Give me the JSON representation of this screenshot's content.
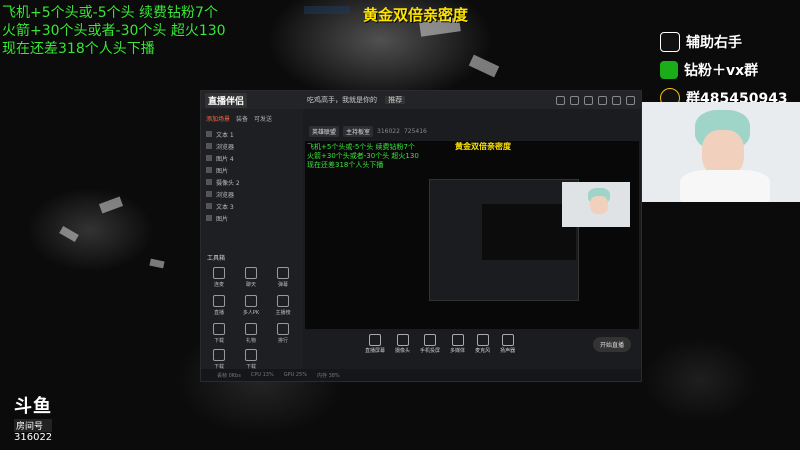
{
  "overlay": {
    "lines": [
      "飞机+5个头或-5个头 续费钻粉7个",
      "火箭+30个头或者-30个头 超火130",
      "现在还差318个人头下播"
    ]
  },
  "banner": "黄金双倍亲密度",
  "social": {
    "douyin": "辅助右手",
    "wechat": "钻粉＋vx群",
    "qq": "群485450943"
  },
  "douyu": {
    "logo": "斗鱼",
    "label": "房间号",
    "room": "316022"
  },
  "app": {
    "title": "直播伴侣",
    "version_badge": "",
    "left_tabs": [
      "添加场景",
      "装备",
      "可发送"
    ],
    "scenes": [
      "文本 1",
      "浏览器",
      "图片 4",
      "图片",
      "摄像头 2",
      "浏览器",
      "文本 3",
      "图片"
    ],
    "tools_title": "工具箱",
    "tools": [
      "连麦",
      "聊天",
      "弹幕",
      "直播",
      "多人PK",
      "主播榜",
      "下载",
      "礼物",
      "排行",
      "下载",
      "下载"
    ],
    "header_tabs": [
      "吃鸡高手，我就是你的",
      "推荐"
    ],
    "chip1": "英雄联盟",
    "chip2": "主持板室",
    "meta_id": "316022",
    "meta_fans": "725416",
    "bottom_buttons": [
      "直播屏幕",
      "摄像头",
      "手机投屏",
      "多媒体",
      "麦克风",
      "扬声器"
    ],
    "start_label": "开始直播",
    "status_message": "",
    "status_items": [
      "丢帧 0Kbs",
      "CPU 13%",
      "GPU 25%",
      "内存 38%"
    ]
  },
  "colors": {
    "overlay_green": "#39e639",
    "banner_yellow": "#ffe400",
    "accent_orange": "#ff6a3d"
  }
}
